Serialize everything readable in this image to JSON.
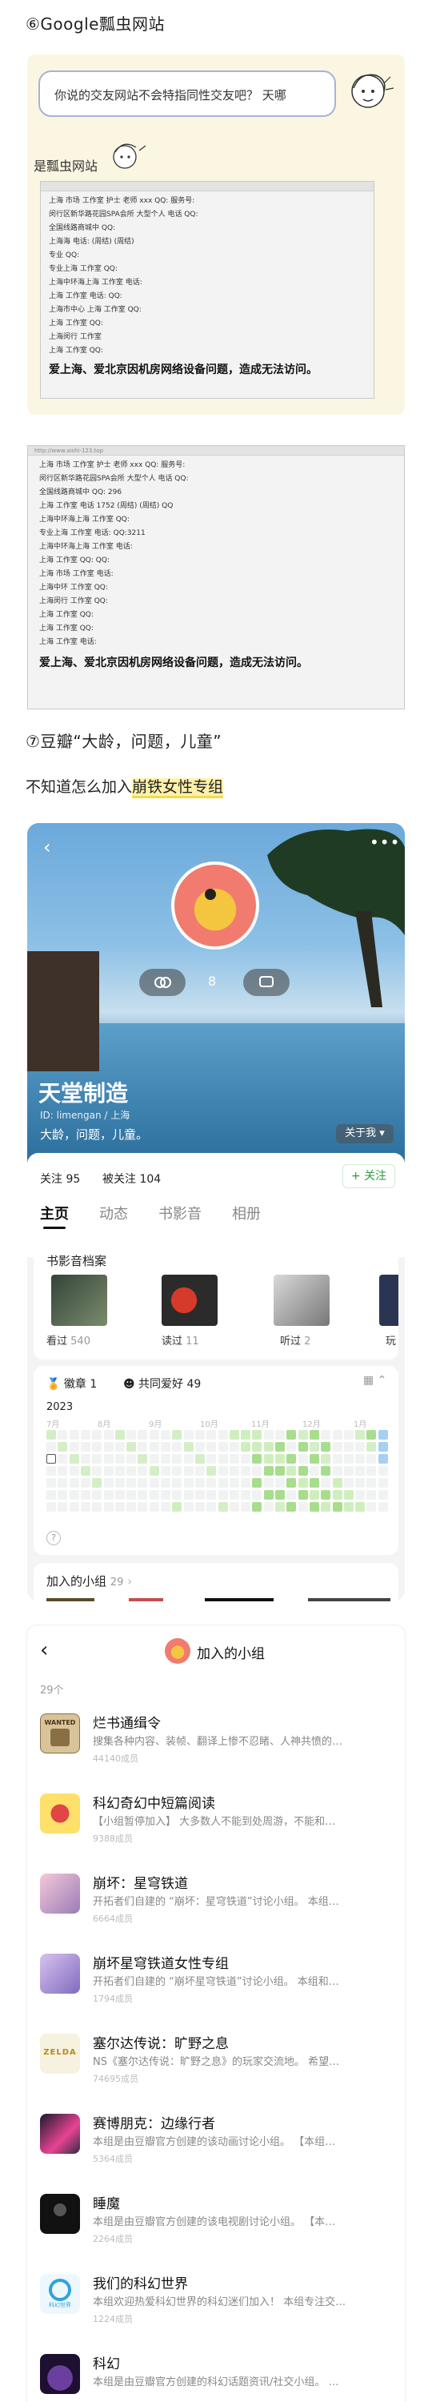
{
  "section6": {
    "heading": "⑥Google瓢虫网站"
  },
  "card1": {
    "bubble_text": "你说的交友网站不会特指同性交友吧？ 天哪",
    "caption": "是瓢虫网站",
    "doc_lines": [
      "上海 市场 工作室 护士 老师 xxx QQ:              服务号:",
      "闵行区新华路花园SPA会所 大型个人 电话 QQ:",
      "全国线路商城中 QQ:",
      "上海海 电话:                (周结)         (周结)",
      "专业 QQ:",
      "专业上海 工作室 QQ:",
      "上海中环海上海 工作室 电话:",
      "上海 工作室 电话:         QQ:",
      "上海市中心 上海 工作室 QQ:",
      "上海 工作室 QQ:",
      "上海闵行 工作室",
      "上海 工作室 QQ:"
    ],
    "doc_bold": "爱上海、爱北京因机房网络设备问题，造成无法访问。"
  },
  "card2": {
    "url": "http://www.aishi-123.top",
    "doc_lines": [
      "上海 市场 工作室 护士 老师 xxx QQ:              服务号:",
      "闵行区新华路花园SPA会所 大型个人 电话 QQ:",
      "全国线路商城中 QQ:  296",
      "上海 工作室 电话 1752        (周结)         (周结)  QQ",
      "上海中环海上海 工作室 QQ:",
      "专业上海 工作室 电话:  QQ:3211",
      "上海中环海上海 工作室 电话:",
      "上海 工作室 QQ:          QQ:",
      "上海 市场 工作室 电话:",
      "上海中环 工作室 QQ:",
      "上海闵行 工作室 QQ:",
      "上海 工作室 QQ:",
      "上海 工作室 QQ:",
      "上海 工作室 电话:"
    ],
    "doc_bold": "爱上海、爱北京因机房网络设备问题，造成无法访问。"
  },
  "section7": {
    "heading": "⑦豆瓣“大龄，问题，儿童”",
    "sub_plain": "不知道怎么加入",
    "sub_highlight": "崩铁女性专组"
  },
  "profile": {
    "name": "天堂制造",
    "id_line": "ID: limengan / 上海",
    "bio": "大龄，问题，儿童。",
    "about_btn": "关于我 ▾",
    "chat_count": "8",
    "following": "关注 95",
    "followers": "被关注 104",
    "follow_btn": "+ 关注",
    "tabs": [
      "主页",
      "动态",
      "书影音",
      "相册"
    ],
    "shuyingyin": {
      "title": "书影音档案",
      "items": [
        {
          "label": "看过",
          "count": "540"
        },
        {
          "label": "读过",
          "count": "11"
        },
        {
          "label": "听过",
          "count": "2"
        },
        {
          "label": "玩",
          "count": ""
        }
      ]
    },
    "badges": {
      "medal": "徽章 1",
      "common": "共同爱好 49"
    },
    "calendar": {
      "year": "2023",
      "months": [
        "7月",
        "8月",
        "9月",
        "10月",
        "11月",
        "12月",
        "1月"
      ]
    },
    "groups_joined": {
      "title": "加入的小组",
      "count": "29"
    }
  },
  "groups_screen": {
    "title": "加入的小组",
    "count": "29个",
    "items": [
      {
        "title": "烂书通缉令",
        "desc": "搜集各种内容、装帧、翻译上惨不忍睹、人神共愤的…",
        "members": "44140成员",
        "thumb_text": "WANTED"
      },
      {
        "title": "科幻奇幻中短篇阅读",
        "desc": "【小组暂停加入】 大多数人不能到处周游，不能和…",
        "members": "9388成员",
        "thumb_text": ""
      },
      {
        "title": "崩坏：星穹铁道",
        "desc": "开拓者们自建的 “崩坏：星穹铁道”讨论小组。 本组…",
        "members": "6664成员",
        "thumb_text": ""
      },
      {
        "title": "崩坏星穹铁道女性专组",
        "desc": "开拓者们自建的 “崩坏星穹铁道”讨论小组。 本组和…",
        "members": "1794成员",
        "thumb_text": ""
      },
      {
        "title": "塞尔达传说：旷野之息",
        "desc": "NS《塞尔达传说：旷野之息》的玩家交流地。 希望…",
        "members": "74695成员",
        "thumb_text": "ZELDA"
      },
      {
        "title": "赛博朋克：边缘行者",
        "desc": "本组是由豆瓣官方创建的该动画讨论小组。 【本组…",
        "members": "5364成员",
        "thumb_text": ""
      },
      {
        "title": "睡魔",
        "desc": "本组是由豆瓣官方创建的该电视剧讨论小组。 【本…",
        "members": "2264成员",
        "thumb_text": ""
      },
      {
        "title": "我们的科幻世界",
        "desc": "本组欢迎热爱科幻世界的科幻迷们加入！ 本组专注交…",
        "members": "1224成员",
        "thumb_text": "科幻世界"
      },
      {
        "title": "科幻",
        "desc": "本组是由豆瓣官方创建的科幻话题资讯/社交小组。 …",
        "members": "",
        "thumb_text": ""
      }
    ]
  }
}
